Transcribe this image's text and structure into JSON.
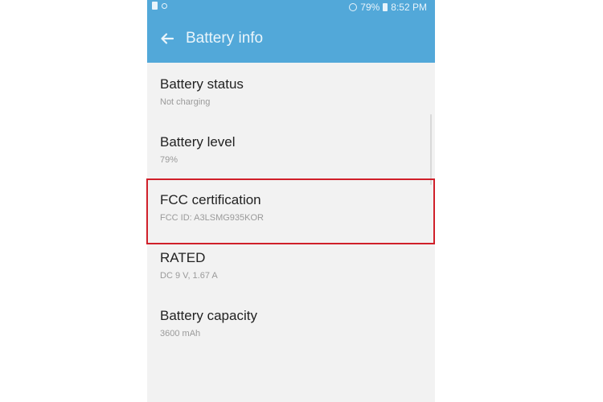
{
  "status_bar": {
    "battery_percent": "79%",
    "time": "8:52 PM"
  },
  "app_bar": {
    "title": "Battery info",
    "back_icon": "arrow-left-icon"
  },
  "items": [
    {
      "title": "Battery status",
      "subtitle": "Not charging"
    },
    {
      "title": "Battery level",
      "subtitle": "79%"
    },
    {
      "title": "FCC certification",
      "subtitle": "FCC ID: A3LSMG935KOR"
    },
    {
      "title": "RATED",
      "subtitle": "DC 9 V, 1.67 A"
    },
    {
      "title": "Battery capacity",
      "subtitle": "3600 mAh"
    }
  ],
  "colors": {
    "accent": "#52a8d9",
    "highlight": "#d0202a"
  }
}
